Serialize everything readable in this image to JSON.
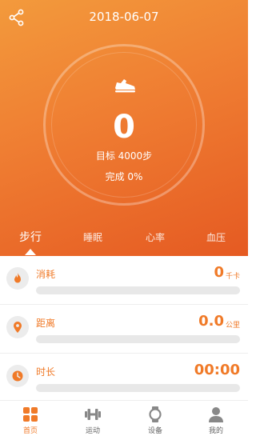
{
  "header": {
    "date": "2018-06-07",
    "share_icon": "share-icon"
  },
  "summary": {
    "step_count": "0",
    "goal_text": "目标 4000步",
    "completion_text": "完成 0%",
    "icon": "shoe-icon"
  },
  "tabs": [
    {
      "label": "步行",
      "active": true
    },
    {
      "label": "睡眠",
      "active": false
    },
    {
      "label": "心率",
      "active": false
    },
    {
      "label": "血压",
      "active": false
    }
  ],
  "metrics": [
    {
      "label": "消耗",
      "value": "0",
      "unit": "千卡",
      "icon": "flame-icon",
      "progress": 0
    },
    {
      "label": "距离",
      "value": "0.0",
      "unit": "公里",
      "icon": "location-pin-icon",
      "progress": 0
    },
    {
      "label": "时长",
      "value": "00:00",
      "unit": "",
      "icon": "clock-icon",
      "progress": 0
    }
  ],
  "nav": [
    {
      "label": "首页",
      "icon": "home-grid-icon",
      "active": true
    },
    {
      "label": "运动",
      "icon": "dumbbell-icon",
      "active": false
    },
    {
      "label": "设备",
      "icon": "watch-icon",
      "active": false
    },
    {
      "label": "我的",
      "icon": "user-icon",
      "active": false
    }
  ],
  "colors": {
    "accent": "#f07a28",
    "gradient_start": "#f39a3c",
    "gradient_end": "#e55a22",
    "track": "#e8e8e8",
    "nav_inactive": "#666666"
  }
}
